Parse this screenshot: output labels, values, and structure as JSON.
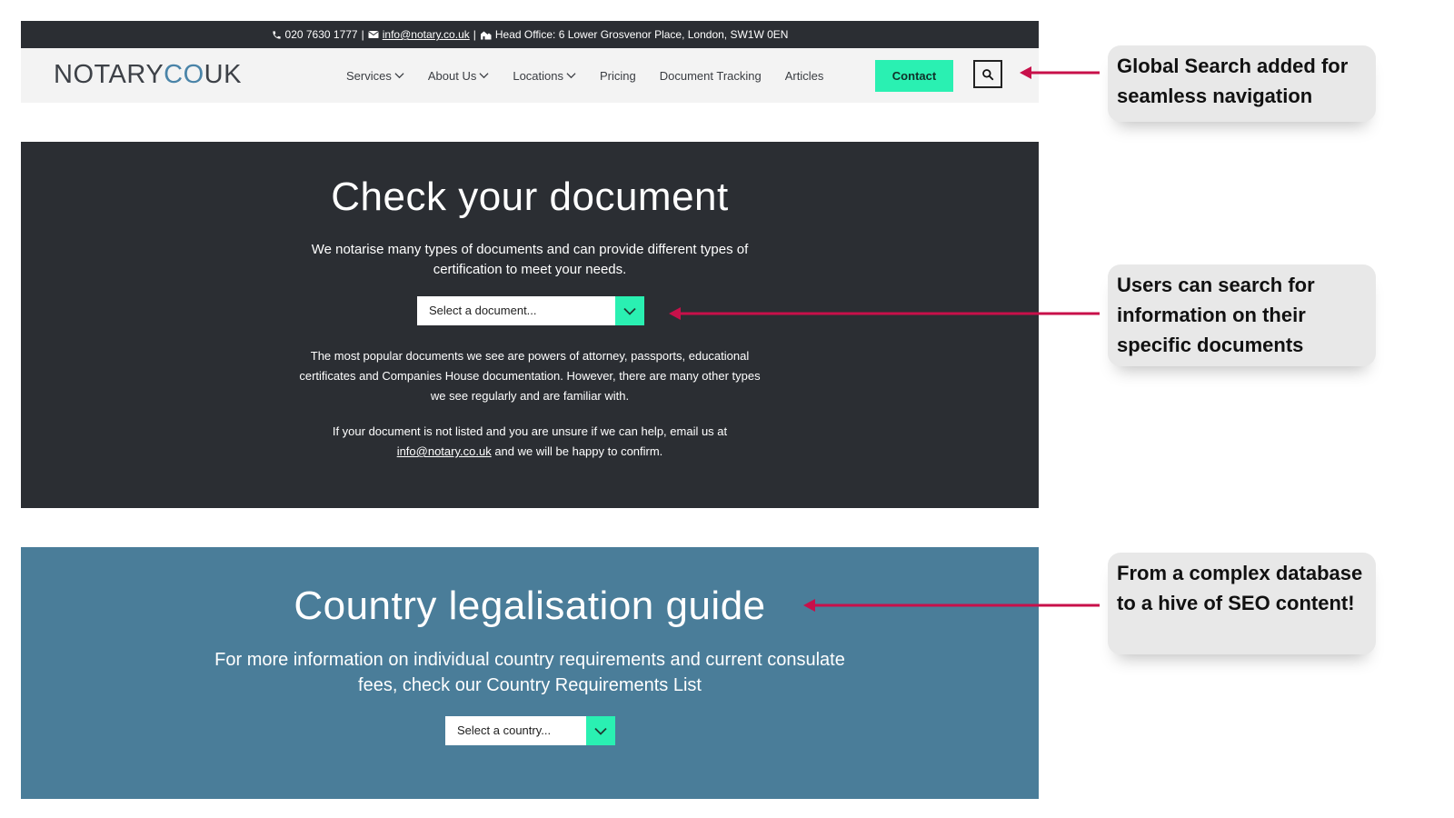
{
  "topbar": {
    "phone": "020 7630 1777",
    "sep1": "|",
    "email": "info@notary.co.uk",
    "sep2": "|",
    "office": "Head Office: 6 Lower Grosvenor Place, London, SW1W 0EN"
  },
  "logo": {
    "part1": "NOTARY",
    "part2": "CO",
    "part3": "UK"
  },
  "nav": {
    "items": [
      {
        "label": "Services",
        "dropdown": true
      },
      {
        "label": "About Us",
        "dropdown": true
      },
      {
        "label": "Locations",
        "dropdown": true
      },
      {
        "label": "Pricing",
        "dropdown": false
      },
      {
        "label": "Document Tracking",
        "dropdown": false
      },
      {
        "label": "Articles",
        "dropdown": false
      }
    ],
    "contact_label": "Contact",
    "search_icon": "search-icon"
  },
  "check_section": {
    "title": "Check your document",
    "intro": "We notarise many types of documents and can provide different types of certification to meet your needs.",
    "select_placeholder": "Select a document...",
    "paragraph2": "The most popular documents we see are powers of attorney, passports, educational certificates and Companies House documentation. However, there are many other types we see regularly and are familiar with.",
    "paragraph3_before": "If your document is not listed and you are unsure if we can help, email us at ",
    "paragraph3_link": "info@notary.co.uk",
    "paragraph3_after": " and we will be happy to confirm."
  },
  "country_section": {
    "title": "Country legalisation guide",
    "intro": "For more information on individual country requirements and current consulate fees, check our Country Requirements List",
    "select_placeholder": "Select a country..."
  },
  "callouts": [
    {
      "text": "Global Search added for seamless navigation"
    },
    {
      "text": "Users can search for information on their specific documents"
    },
    {
      "text": "From a complex database to a hive of SEO content!"
    }
  ],
  "colors": {
    "dark": "#2b2e33",
    "accent_green": "#2af0b2",
    "blue_section": "#4a7d99",
    "logo_blue": "#4a84a8",
    "arrow": "#c8104a"
  }
}
